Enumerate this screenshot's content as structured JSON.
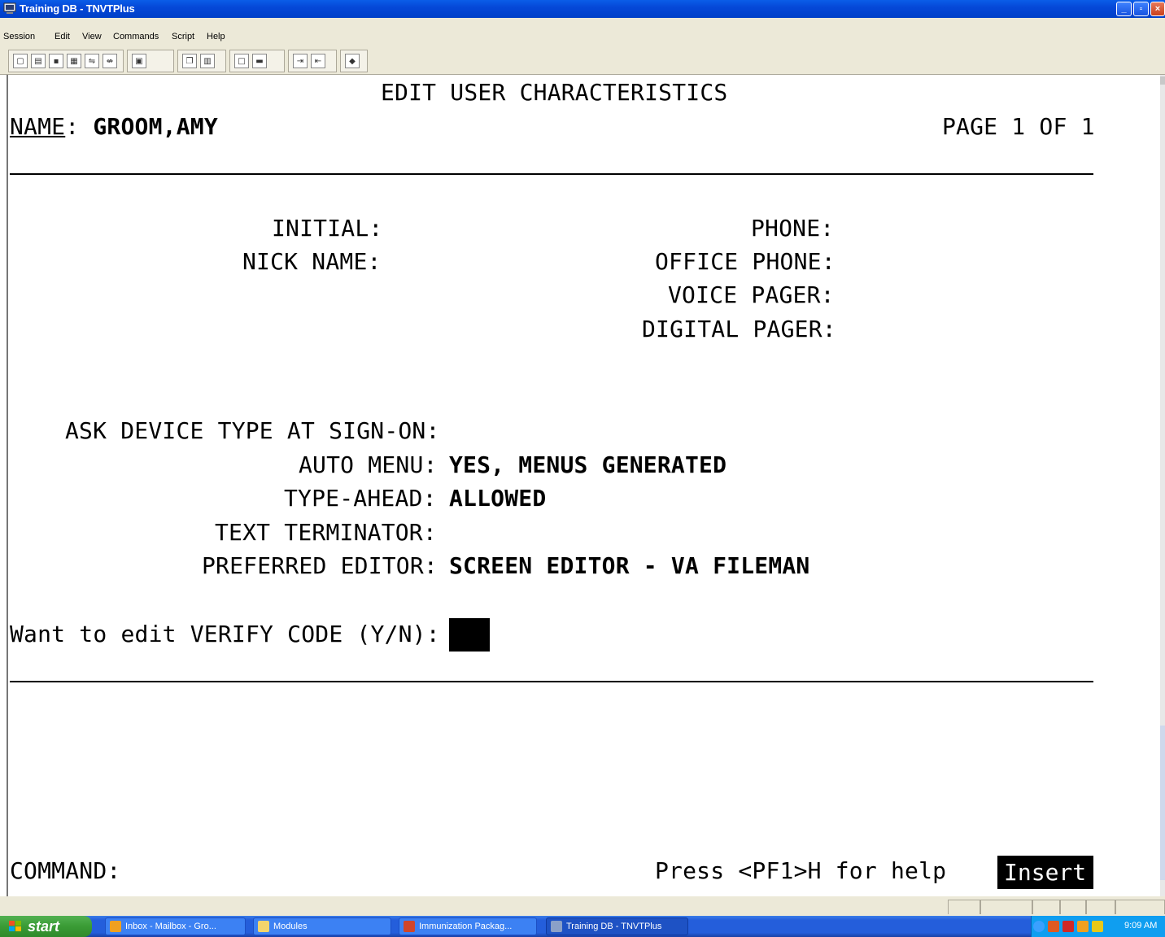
{
  "window": {
    "title": "Training DB - TNVTPlus"
  },
  "menu": [
    "Session",
    "Edit",
    "View",
    "Commands",
    "Script",
    "Help"
  ],
  "toolbar": {
    "icons": [
      "new-session-icon",
      "open-icon",
      "save-icon",
      "properties-icon",
      "connect-icon",
      "disconnect-icon",
      "print-icon",
      "copy-icon",
      "paste-icon",
      "screen-icon",
      "keyboard-icon",
      "send-file-icon",
      "receive-file-icon",
      "help-book-icon"
    ]
  },
  "screen": {
    "heading": "EDIT USER CHARACTERISTICS",
    "name_label": "NAME",
    "name_colon": ":",
    "name_value": "GROOM,AMY",
    "page_info": "PAGE 1 OF 1",
    "fields_left": [
      {
        "label": "INITIAL:"
      },
      {
        "label": "NICK NAME:"
      }
    ],
    "fields_right": [
      {
        "label": "PHONE:"
      },
      {
        "label": "OFFICE PHONE:"
      },
      {
        "label": "VOICE PAGER:"
      },
      {
        "label": "DIGITAL PAGER:"
      }
    ],
    "settings": [
      {
        "label": "ASK DEVICE TYPE AT SIGN-ON:",
        "value": ""
      },
      {
        "label": "AUTO MENU:",
        "value": "YES, MENUS GENERATED"
      },
      {
        "label": "TYPE-AHEAD:",
        "value": "ALLOWED"
      },
      {
        "label": "TEXT TERMINATOR:",
        "value": ""
      },
      {
        "label": "PREFERRED EDITOR:",
        "value": "SCREEN EDITOR - VA FILEMAN"
      }
    ],
    "prompt": "Want to edit VERIFY CODE (Y/N):",
    "command_label": "COMMAND:",
    "help_hint": "Press <PF1>H for help",
    "mode": "Insert"
  },
  "taskbar": {
    "start_label": "start",
    "tasks": [
      {
        "label": "Inbox - Mailbox - Gro...",
        "icon": "outlook-icon",
        "color": "#f0a020"
      },
      {
        "label": "Modules",
        "icon": "folder-icon",
        "color": "#f4d46c"
      },
      {
        "label": "Immunization Packag...",
        "icon": "powerpoint-icon",
        "color": "#d0452a"
      },
      {
        "label": "Training DB - TNVTPlus",
        "icon": "terminal-icon",
        "color": "#8aa0c8"
      }
    ],
    "clock": "9:09 AM"
  },
  "colors": {
    "titlebar": "#0548d8",
    "chrome": "#ece9d8",
    "terminal_bg": "#ffffff",
    "terminal_fg": "#000000"
  }
}
